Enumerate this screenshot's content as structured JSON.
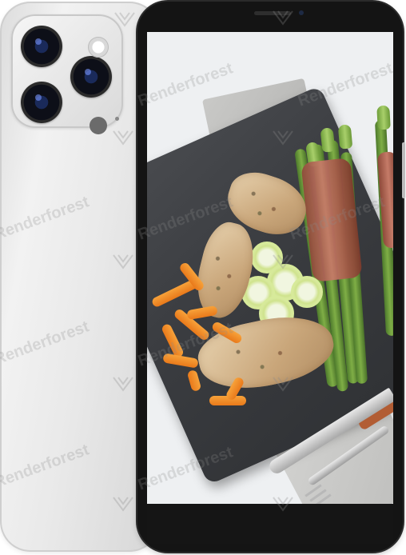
{
  "watermark": {
    "brand_text": "Renderforest",
    "logo_icon": "renderforest-logo-icon"
  },
  "colors": {
    "back_phone": "#e9e9e9",
    "front_bezel": "#141414",
    "plate": "#3a3c40",
    "asparagus": "#7fae46",
    "carrot": "#f39a2f",
    "chicken": "#d2b286"
  },
  "icons": {
    "camera_lens": "camera-lens-icon",
    "flash": "flash-icon",
    "lidar": "lidar-sensor-icon",
    "speaker": "speaker-grille-icon",
    "front_camera": "front-camera-icon"
  }
}
